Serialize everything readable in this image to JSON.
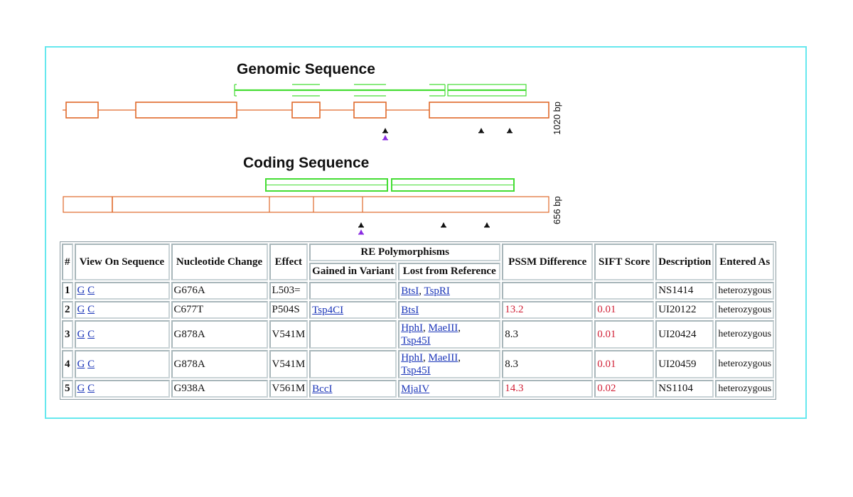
{
  "genomic": {
    "title": "Genomic Sequence",
    "length_label": "1020 bp",
    "length_bp": 1020,
    "colors": {
      "exon": "#e0692a",
      "domain": "#44dd33",
      "snp": "#111111",
      "snp_selected": "#8a2be2"
    }
  },
  "coding": {
    "title": "Coding Sequence",
    "length_label": "656 bp",
    "length_bp": 656
  },
  "table": {
    "headers": {
      "num": "#",
      "view": "View On Sequence",
      "nucleotide": "Nucleotide Change",
      "effect": "Effect",
      "re_group": "RE Polymorphisms",
      "gained": "Gained in Variant",
      "lost": "Lost from Reference",
      "pssm": "PSSM Difference",
      "sift": "SIFT Score",
      "description": "Description",
      "entered": "Entered As"
    },
    "rows": [
      {
        "num": "1",
        "g": "G",
        "c": "C",
        "nucleotide": "G676A",
        "effect": "L503=",
        "gained": [],
        "lost": [
          "BtsI",
          "TspRI"
        ],
        "pssm": "",
        "pssm_flag": false,
        "sift": "",
        "sift_flag": false,
        "description": "NS1414",
        "entered": "heterozygous"
      },
      {
        "num": "2",
        "g": "G",
        "c": "C",
        "nucleotide": "C677T",
        "effect": "P504S",
        "gained": [
          "Tsp4CI"
        ],
        "lost": [
          "BtsI"
        ],
        "pssm": "13.2",
        "pssm_flag": true,
        "sift": "0.01",
        "sift_flag": true,
        "description": "UI20122",
        "entered": "heterozygous"
      },
      {
        "num": "3",
        "g": "G",
        "c": "C",
        "nucleotide": "G878A",
        "effect": "V541M",
        "gained": [],
        "lost": [
          "HphI",
          "MaeIII",
          "Tsp45I"
        ],
        "pssm": "8.3",
        "pssm_flag": false,
        "sift": "0.01",
        "sift_flag": true,
        "description": "UI20424",
        "entered": "heterozygous"
      },
      {
        "num": "4",
        "g": "G",
        "c": "C",
        "nucleotide": "G878A",
        "effect": "V541M",
        "gained": [],
        "lost": [
          "HphI",
          "MaeIII",
          "Tsp45I"
        ],
        "pssm": "8.3",
        "pssm_flag": false,
        "sift": "0.01",
        "sift_flag": true,
        "description": "UI20459",
        "entered": "heterozygous"
      },
      {
        "num": "5",
        "g": "G",
        "c": "C",
        "nucleotide": "G938A",
        "effect": "V561M",
        "gained": [
          "BccI"
        ],
        "lost": [
          "MjaIV"
        ],
        "pssm": "14.3",
        "pssm_flag": true,
        "sift": "0.02",
        "sift_flag": true,
        "description": "NS1104",
        "entered": "heterozygous"
      }
    ]
  }
}
